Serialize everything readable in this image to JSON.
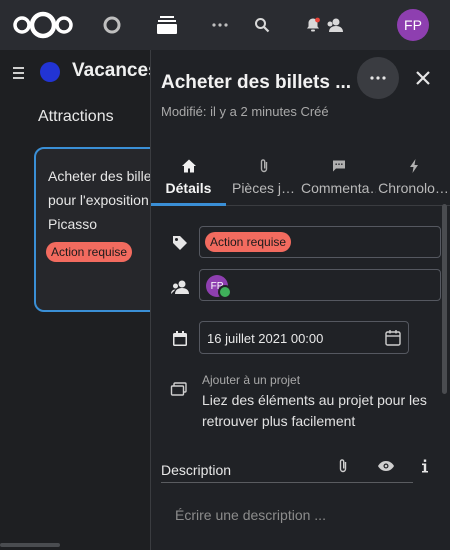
{
  "header": {
    "avatar_initials": "FP",
    "icons": [
      "nextcloud-logo-icon",
      "files-app-icon",
      "deck-app-icon",
      "more-apps-icon",
      "search-icon",
      "notifications-icon",
      "contacts-icon"
    ]
  },
  "board": {
    "name": "Vacances",
    "color": "#2234d4",
    "stack_title": "Attractions",
    "card": {
      "title": "Acheter des billets pour l'exposition Picasso",
      "label": "Action requise"
    }
  },
  "sidebar": {
    "title": "Acheter des billets ...",
    "subtitle": "Modifié: il y a 2 minutes Créé",
    "tabs": [
      {
        "label": "Détails",
        "icon": "home-icon",
        "active": true
      },
      {
        "label": "Pièces jointes",
        "icon": "paperclip-icon",
        "active": false
      },
      {
        "label": "Commentaires",
        "icon": "comment-icon",
        "active": false
      },
      {
        "label": "Chronologie",
        "icon": "lightning-icon",
        "active": false
      }
    ],
    "labels": [
      "Action requise"
    ],
    "assignee_initials": "FP",
    "due_date": "16 juillet 2021 00:00",
    "project": {
      "heading": "Ajouter à un projet",
      "description": "Liez des éléments au projet pour les retrouver plus facilement"
    },
    "description": {
      "label": "Description",
      "placeholder": "Écrire une description ..."
    }
  },
  "colors": {
    "accent": "#3a8fd6",
    "label": "#f26b5f",
    "avatar": "#8e3fb0",
    "status_online": "#3fb05a"
  }
}
